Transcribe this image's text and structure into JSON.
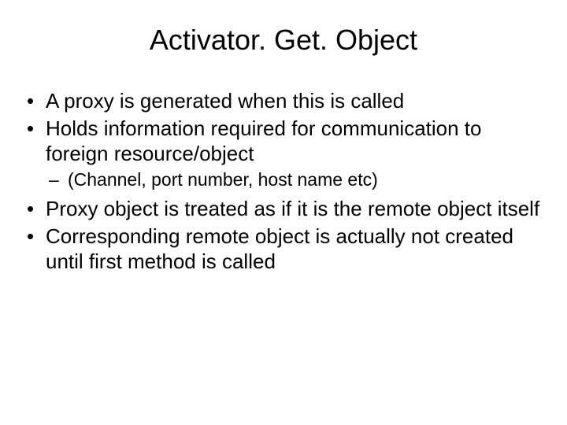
{
  "title": "Activator. Get. Object",
  "bullets": {
    "b0": "A proxy is generated when this is called",
    "b1": "Holds information required for communication to foreign resource/object",
    "b1_sub0": "(Channel, port number, host name etc)",
    "b2": "Proxy object is treated as if it is the remote object itself",
    "b3": "Corresponding remote object is actually not created until first method is called"
  }
}
